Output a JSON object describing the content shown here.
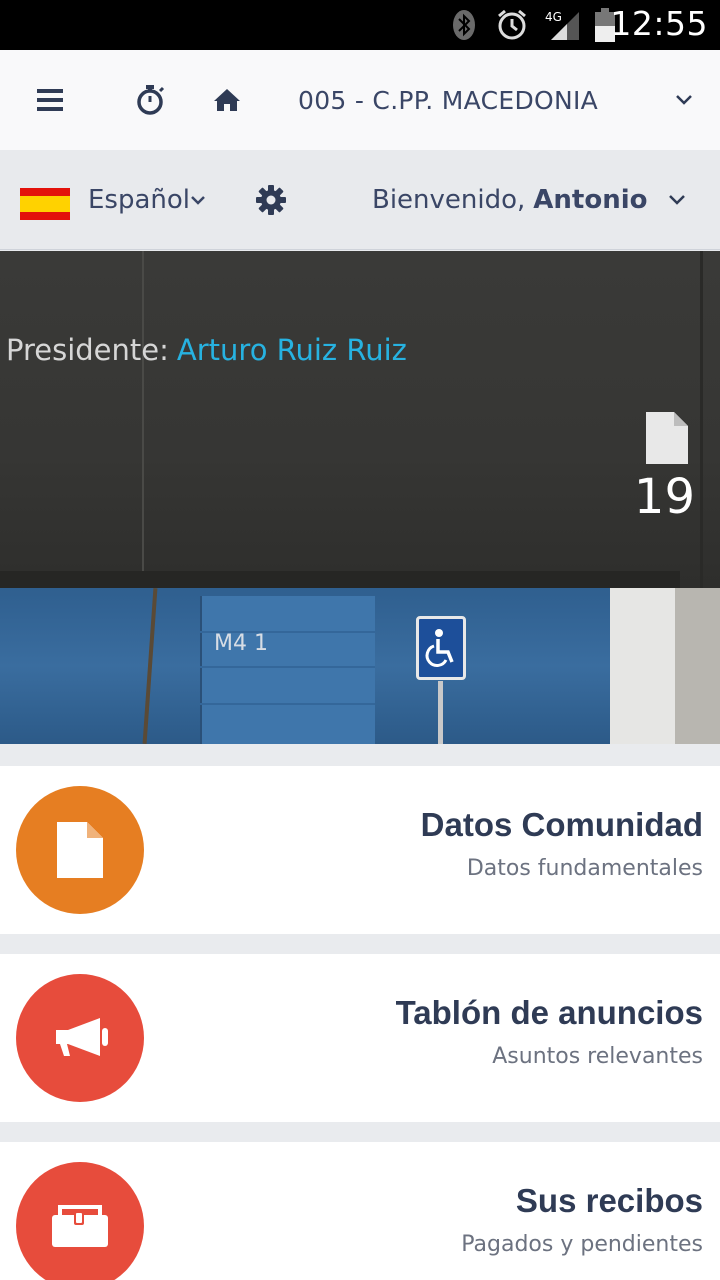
{
  "status_bar": {
    "time": "12:55",
    "network": "4G",
    "icons": [
      "bluetooth-icon",
      "alarm-icon",
      "signal-icon",
      "battery-icon"
    ]
  },
  "top_nav": {
    "icons": [
      "menu-icon",
      "stopwatch-icon",
      "home-icon",
      "chevron-down-icon"
    ],
    "community": "005 - C.PP. MACEDONIA"
  },
  "user_bar": {
    "language": "Español",
    "welcome_prefix": "Bienvenido,",
    "user_name": "Antonio",
    "icons": [
      "spain-flag-icon",
      "chevron-down-icon",
      "gear-icon",
      "chevron-down-icon"
    ]
  },
  "hero": {
    "president_label": "Presidente:",
    "president_name": "Arturo Ruiz Ruiz",
    "document_count": "19",
    "sign_text": "M4 1"
  },
  "cards": [
    {
      "title": "Datos Comunidad",
      "subtitle": "Datos fundamentales",
      "icon": "document-icon",
      "color": "#e67e22"
    },
    {
      "title": "Tablón de anuncios",
      "subtitle": "Asuntos relevantes",
      "icon": "megaphone-icon",
      "color": "#e74c3c"
    },
    {
      "title": "Sus recibos",
      "subtitle": "Pagados y pendientes",
      "icon": "wallet-icon",
      "color": "#e74c3c"
    }
  ],
  "colors": {
    "accent_blue": "#27b2e1",
    "text_dark": "#2f3b55",
    "orange": "#e67e22",
    "red": "#e74c3c"
  }
}
